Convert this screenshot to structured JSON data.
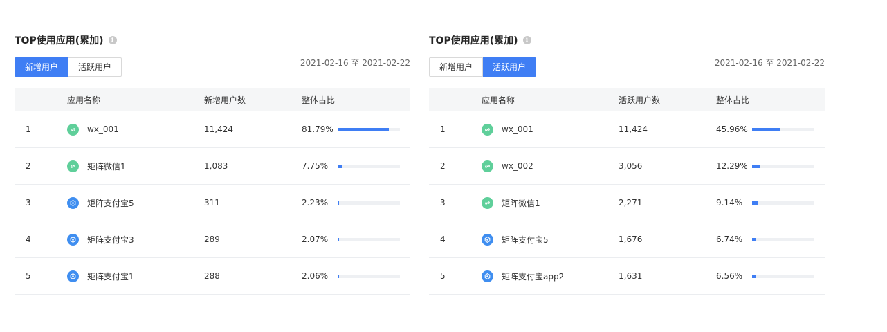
{
  "panels": [
    {
      "title": "TOP使用应用(累加)",
      "tabs": [
        {
          "label": "新增用户",
          "active": true
        },
        {
          "label": "活跃用户",
          "active": false
        }
      ],
      "date_range": "2021-02-16 至 2021-02-22",
      "columns": {
        "index": "",
        "name": "应用名称",
        "count": "新增用户数",
        "share": "整体占比"
      },
      "rows": [
        {
          "index": "1",
          "icon": "wechat",
          "name": "wx_001",
          "count": "11,424",
          "share": "81.79%",
          "share_value": 81.79
        },
        {
          "index": "2",
          "icon": "wechat",
          "name": "矩阵微信1",
          "count": "1,083",
          "share": "7.75%",
          "share_value": 7.75
        },
        {
          "index": "3",
          "icon": "alipay",
          "name": "矩阵支付宝5",
          "count": "311",
          "share": "2.23%",
          "share_value": 2.23
        },
        {
          "index": "4",
          "icon": "alipay",
          "name": "矩阵支付宝3",
          "count": "289",
          "share": "2.07%",
          "share_value": 2.07
        },
        {
          "index": "5",
          "icon": "alipay",
          "name": "矩阵支付宝1",
          "count": "288",
          "share": "2.06%",
          "share_value": 2.06
        }
      ]
    },
    {
      "title": "TOP使用应用(累加)",
      "tabs": [
        {
          "label": "新增用户",
          "active": false
        },
        {
          "label": "活跃用户",
          "active": true
        }
      ],
      "date_range": "2021-02-16 至 2021-02-22",
      "columns": {
        "index": "",
        "name": "应用名称",
        "count": "活跃用户数",
        "share": "整体占比"
      },
      "rows": [
        {
          "index": "1",
          "icon": "wechat",
          "name": "wx_001",
          "count": "11,424",
          "share": "45.96%",
          "share_value": 45.96
        },
        {
          "index": "2",
          "icon": "wechat",
          "name": "wx_002",
          "count": "3,056",
          "share": "12.29%",
          "share_value": 12.29
        },
        {
          "index": "3",
          "icon": "wechat",
          "name": "矩阵微信1",
          "count": "2,271",
          "share": "9.14%",
          "share_value": 9.14
        },
        {
          "index": "4",
          "icon": "alipay",
          "name": "矩阵支付宝5",
          "count": "1,676",
          "share": "6.74%",
          "share_value": 6.74
        },
        {
          "index": "5",
          "icon": "alipay",
          "name": "矩阵支付宝app2",
          "count": "1,631",
          "share": "6.56%",
          "share_value": 6.56
        }
      ]
    }
  ],
  "icons": {
    "wechat": "mini-program-link-icon",
    "alipay": "alipay-mini-app-icon",
    "info": "info-icon"
  },
  "colors": {
    "accent": "#3f7ef4",
    "wechat": "#5fcf9a",
    "alipay": "#3f8ef0",
    "track": "#eef0f3",
    "header_bg": "#f5f6f7"
  }
}
